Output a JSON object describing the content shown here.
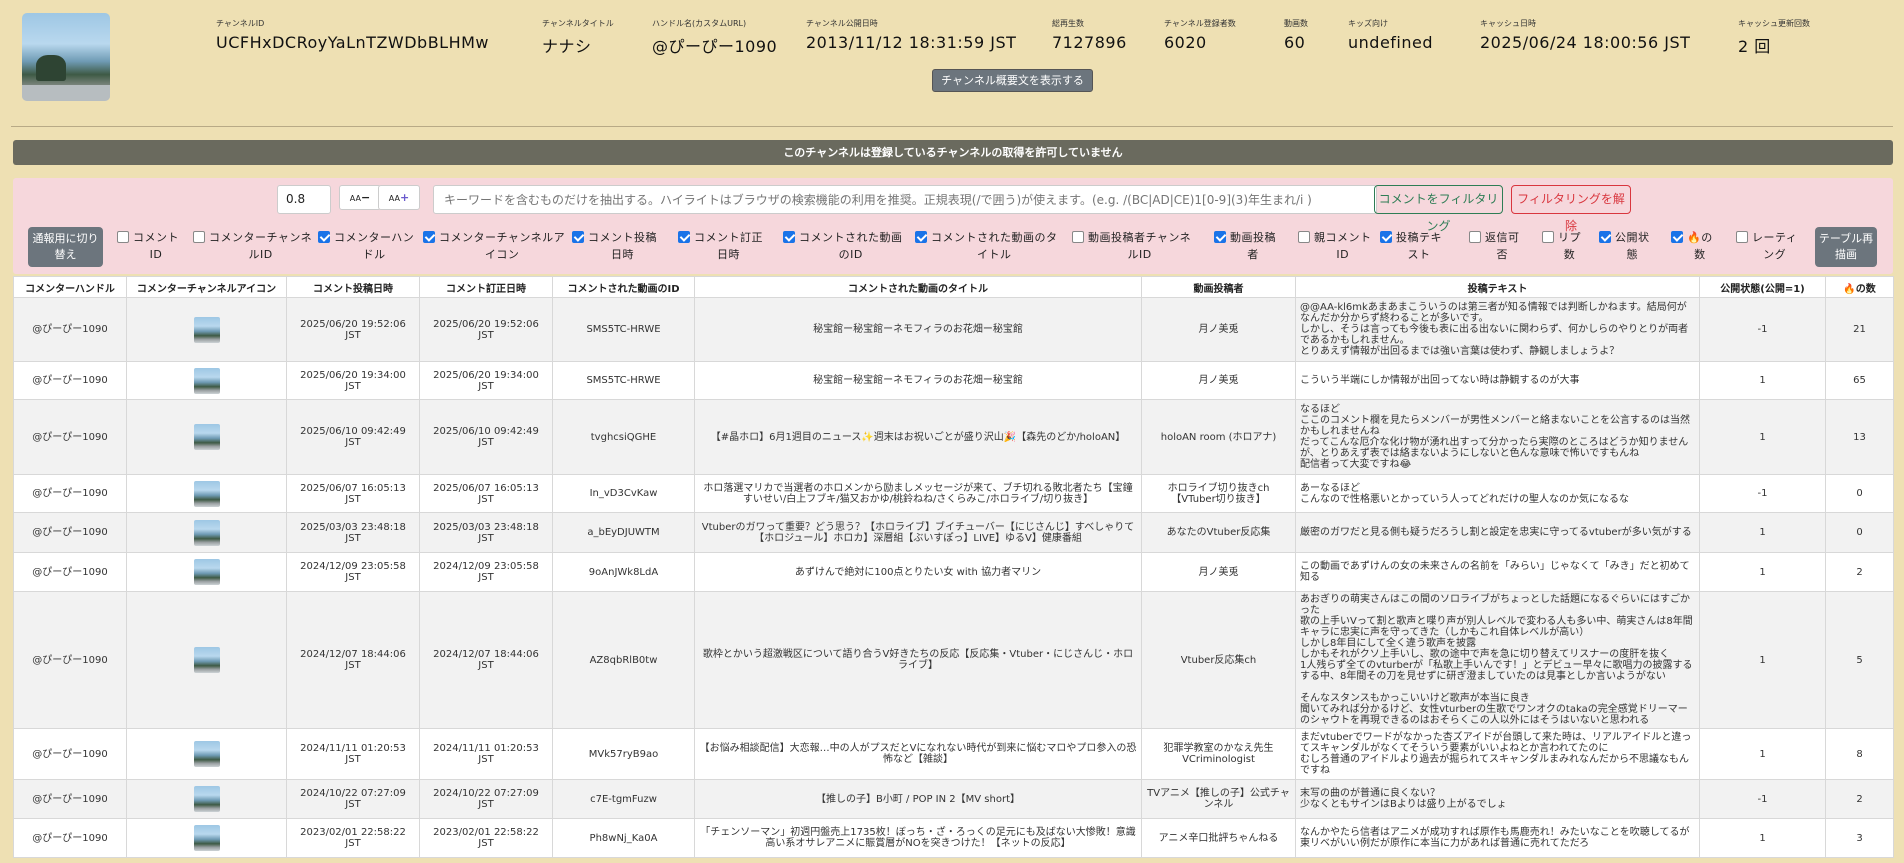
{
  "channel": {
    "fields": [
      {
        "label": "チャンネルID",
        "value": "UCFHxDCRoyYaLnTZWDbBLHMw"
      },
      {
        "label": "チャンネルタイトル",
        "value": "ナナシ"
      },
      {
        "label": "ハンドル名(カスタムURL)",
        "value": "@ぴーぴー1090"
      },
      {
        "label": "チャンネル公開日時",
        "value": "2013/11/12 18:31:59 JST"
      },
      {
        "label": "総再生数",
        "value": "7127896"
      },
      {
        "label": "チャンネル登録者数",
        "value": "6020"
      },
      {
        "label": "動画数",
        "value": "60"
      },
      {
        "label": "キッズ向け",
        "value": "undefined"
      },
      {
        "label": "キャッシュ日時",
        "value": "2025/06/24 18:00:56 JST"
      },
      {
        "label": "キャッシュ更新回数",
        "value": "2 回"
      }
    ],
    "about_button": "チャンネル概要文を表示する"
  },
  "warning": "このチャンネルは登録しているチャンネルの取得を許可していません",
  "filter": {
    "zoom_value": "0.8",
    "zoom_out_label": "A",
    "zoom_in_label": "A",
    "keyword_placeholder": "キーワードを含むものだけを抽出する。ハイライトはブラウザの検索機能の利用を推奨。正規表現(/で囲う)が使えます。(e.g. /(BC|AD|CE)1[0-9](3)年生まれ/i )",
    "filter_button": "コメントをフィルタリング",
    "unfilter_button": "フィルタリングを解除",
    "mode_button": "通報用に切り替え",
    "redraw_button": "テーブル再描画",
    "columns": [
      {
        "label": "コメントID",
        "checked": false
      },
      {
        "label": "コメンターチャンネルID",
        "checked": false
      },
      {
        "label": "コメンターハンドル",
        "checked": true
      },
      {
        "label": "コメンターチャンネルアイコン",
        "checked": true
      },
      {
        "label": "コメント投稿日時",
        "checked": true
      },
      {
        "label": "コメント訂正日時",
        "checked": true
      },
      {
        "label": "コメントされた動画のID",
        "checked": true
      },
      {
        "label": "コメントされた動画のタイトル",
        "checked": true
      },
      {
        "label": "動画投稿者チャンネルID",
        "checked": false
      },
      {
        "label": "動画投稿者",
        "checked": true
      },
      {
        "label": "親コメントID",
        "checked": false
      },
      {
        "label": "投稿テキスト",
        "checked": true
      },
      {
        "label": "返信可否",
        "checked": false
      },
      {
        "label": "リプ数",
        "checked": false
      },
      {
        "label": "公開状態",
        "checked": true
      },
      {
        "label": "🔥の数",
        "checked": true
      },
      {
        "label": "レーティング",
        "checked": false
      }
    ]
  },
  "table": {
    "headers": [
      "コメンターハンドル",
      "コメンターチャンネルアイコン",
      "コメント投稿日時",
      "コメント訂正日時",
      "コメントされた動画のID",
      "コメントされた動画のタイトル",
      "動画投稿者",
      "投稿テキスト",
      "公開状態(公開=1)",
      "🔥の数"
    ],
    "rows": [
      {
        "handle": "@ぴーぴー1090",
        "posted": "2025/06/20 19:52:06 JST",
        "edited": "2025/06/20 19:52:06 JST",
        "video_id": "SMS5TC-HRWE",
        "title": "秘宝館ー秘宝館ーネモフィラのお花畑ー秘宝館",
        "author": "月ノ美兎",
        "text": "@@AA-kl6mkあまあまこういうのは第三者が知る情報では判断しかねます。結局何がなんだか分からず終わることが多いです。\nしかし、そうは言っても今後も表に出る出ないに関わらず、何かしらのやりとりが両者であるかもしれません。\nとりあえず情報が出回るまでは強い言葉は使わず、静観しましょうよ？",
        "public": "-1",
        "fire": "21",
        "h": 64
      },
      {
        "handle": "@ぴーぴー1090",
        "posted": "2025/06/20 19:34:00 JST",
        "edited": "2025/06/20 19:34:00 JST",
        "video_id": "SMS5TC-HRWE",
        "title": "秘宝館ー秘宝館ーネモフィラのお花畑ー秘宝館",
        "author": "月ノ美兎",
        "text": "こういう半端にしか情報が出回ってない時は静観するのが大事",
        "public": "1",
        "fire": "65",
        "h": 38
      },
      {
        "handle": "@ぴーぴー1090",
        "posted": "2025/06/10 09:42:49 JST",
        "edited": "2025/06/10 09:42:49 JST",
        "video_id": "tvghcsiQGHE",
        "title": "【#晶ホロ】6月1週目のニュース✨週末はお祝いごとが盛り沢山🎉【森先のどか/holoAN】",
        "author": "holoAN room (ホロアナ)",
        "text": "なるほど\nここのコメント欄を見たらメンバーが男性メンバーと絡まないことを公言するのは当然かもしれませんね\nだってこんな厄介な化け物が湧れ出すって分かったら実際のところはどうか知りませんが、とりあえず表では絡まないようにしないと色んな意味で怖いですもんね\n配信者って大変ですね😂",
        "public": "1",
        "fire": "13",
        "h": 75
      },
      {
        "handle": "@ぴーぴー1090",
        "posted": "2025/06/07 16:05:13 JST",
        "edited": "2025/06/07 16:05:13 JST",
        "video_id": "In_vD3CvKaw",
        "title": "ホロ落選マリカで当選者のホロメンから励ましメッセージが来て、ブチ切れる敗北者たち【宝鐘すいせい/白上フブキ/猫又おかゆ/桃鈴ねね/さくらみこ/ホロライブ/切り抜き】",
        "author": "ホロライブ切り抜きch【VTuber切り抜き】",
        "text": "あーなるほど\nこんなので性格悪いとかっていう人ってどれだけの聖人なのか気になるな",
        "public": "-1",
        "fire": "0",
        "h": 38
      },
      {
        "handle": "@ぴーぴー1090",
        "posted": "2025/03/03 23:48:18 JST",
        "edited": "2025/03/03 23:48:18 JST",
        "video_id": "a_bEyDJUWTM",
        "title": "Vtuberのガワって重要？どう思う？【ホロライブ】ブイチューバー【にじさんじ】すべしゃりて【ホロジュール】ホロカ】深層組【ぶいすぽっ】LIVE】ゆるV】健康番組",
        "author": "あなたのVtuber反応集",
        "text": "厳密のガワだと見る側も疑うだろうし割と設定を忠実に守ってるvtuberが多い気がする",
        "public": "1",
        "fire": "0",
        "h": 40
      },
      {
        "handle": "@ぴーぴー1090",
        "posted": "2024/12/09 23:05:58 JST",
        "edited": "2024/12/09 23:05:58 JST",
        "video_id": "9oAnJWk8LdA",
        "title": "あずけんで絶対に100点とりたい女 with 協力者マリン",
        "author": "月ノ美兎",
        "text": "この動画であずけんの女の未来さんの名前を「みらい」じゃなくて「みき」だと初めて知る",
        "public": "1",
        "fire": "2",
        "h": 39
      },
      {
        "handle": "@ぴーぴー1090",
        "posted": "2024/12/07 18:44:06 JST",
        "edited": "2024/12/07 18:44:06 JST",
        "video_id": "AZ8qbRlB0tw",
        "title": "歌枠とかいう超激戦区について語り合うV好きたちの反応【反応集・Vtuber・にじさんじ・ホロライブ】",
        "author": "Vtuber反応集ch",
        "text": "あおぎりの萌実さんはこの間のソロライブがちょっとした話題になるぐらいにはすごかった\n歌の上手いVって割と歌声と喋り声が別人レベルで変わる人も多い中、萌実さんは8年間キャラに忠実に声を守ってきた（しかもこれ自体レベルが高い）\nしかし8年目にして全く違う歌声を披露\nしかもそれがクソ上手いし、歌の途中で声を急に切り替えてリスナーの度肝を抜く\n1人残らず全てのvturberが「私歌上手いんです！」とデビュー早々に歌唱力の披露するする中、8年間その刀を見せずに研ぎ澄ましていたのは見事としか言いようがない\n\nそんなスタンスもかっこいいけど歌声が本当に良き\n聞いてみれば分かるけど、女性vturberの生歌でワンオクのtakaの完全感覚ドリーマーのシャウトを再現できるのはおそらくこの人以外にはそうはいないと思われる",
        "public": "1",
        "fire": "5",
        "h": 127
      },
      {
        "handle": "@ぴーぴー1090",
        "posted": "2024/11/11 01:20:53 JST",
        "edited": "2024/11/11 01:20:53 JST",
        "video_id": "MVk57ryB9ao",
        "title": "【お悩み相談配信】大恋報…中の人がプスだとVになれない時代が到来に悩むマロやプロ参入の恐怖など【雑談】",
        "author": "犯罪学教室のかなえ先生 VCriminologist",
        "text": "まだvtuberでワードがなかった杏ズアイドが台頭して来た時は、リアルアイドルと違ってスキャンダルがなくてそういう要素がいいよねとか言われてたのに\nむしろ普通のアイドルより過去が掘られてスキャンダルまみれなんだから不思議なもんですね",
        "public": "1",
        "fire": "8",
        "h": 51
      },
      {
        "handle": "@ぴーぴー1090",
        "posted": "2024/10/22 07:27:09 JST",
        "edited": "2024/10/22 07:27:09 JST",
        "video_id": "c7E-tgmFuzw",
        "title": "【推しの子】B小町 / POP IN 2【MV short】",
        "author": "TVアニメ【推しの子】公式チャンネル",
        "text": "末写の曲のが普通に良くない？\n少なくともサインはBよりは盛り上がるでしょ",
        "public": "-1",
        "fire": "2",
        "h": 39
      },
      {
        "handle": "@ぴーぴー1090",
        "posted": "2023/02/01 22:58:22 JST",
        "edited": "2023/02/01 22:58:22 JST",
        "video_id": "Ph8wNj_Ka0A",
        "title": "「チェンソーマン」初週円盤売上1735枚！ぼっち・ざ・ろっくの足元にも及ばない大惨敗！意識高い系オサレアニメに賑賞層がNOを突きつけた！【ネットの反応】",
        "author": "アニメ辛口批評ちゃんねる",
        "text": "なんかやたら信者はアニメが成功すれば原作も馬鹿売れ！みたいなことを吹聴してるが東リベがいい例だが原作に本当に力があれば普通に売れてただろ",
        "public": "1",
        "fire": "3",
        "h": 39
      }
    ]
  }
}
